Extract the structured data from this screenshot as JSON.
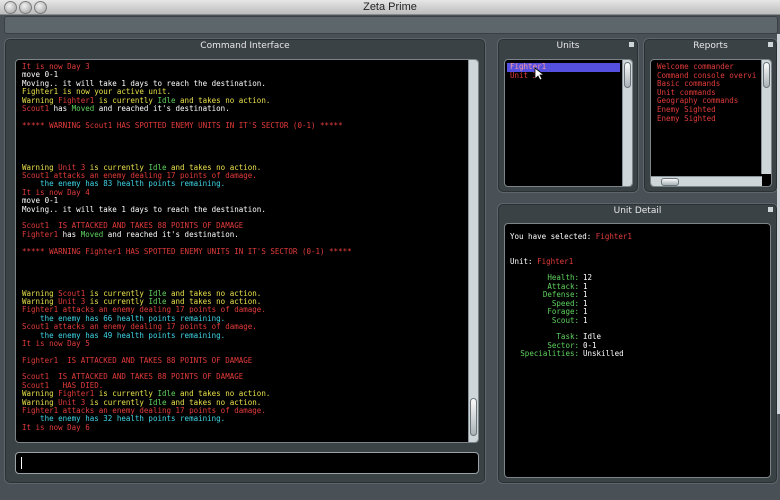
{
  "window": {
    "title": "Zeta Prime"
  },
  "command_panel": {
    "title": "Command Interface",
    "lines": [
      [
        {
          "t": "It is now Day 3",
          "c": "#e33b3b"
        }
      ],
      [
        {
          "t": "move 0-1",
          "c": "#ffffff"
        }
      ],
      [
        {
          "t": "Moving.. it will take 1 days to reach the destination.",
          "c": "#ffffff"
        }
      ],
      [
        {
          "t": "Fighter1 is now your active unit.",
          "c": "#e8e04a"
        }
      ],
      [
        {
          "t": "Warning ",
          "c": "#e8e04a"
        },
        {
          "t": "Fighter1",
          "c": "#e33b3b"
        },
        {
          "t": " is currently ",
          "c": "#e8e04a"
        },
        {
          "t": "Idle",
          "c": "#5fd35f"
        },
        {
          "t": " and takes no action.",
          "c": "#e8e04a"
        }
      ],
      [
        {
          "t": "Scout1",
          "c": "#e33b3b"
        },
        {
          "t": " has ",
          "c": "#ffffff"
        },
        {
          "t": "Moved",
          "c": "#5fd35f"
        },
        {
          "t": " and reached it's destination.",
          "c": "#ffffff"
        }
      ],
      [],
      [
        {
          "t": "***** WARNING Scout1 HAS SPOTTED ENEMY UNITS IN IT'S SECTOR (0-1) *****",
          "c": "#e33b3b"
        }
      ],
      [],
      [],
      [],
      [],
      [
        {
          "t": "Warning ",
          "c": "#e8e04a"
        },
        {
          "t": "Unit 3",
          "c": "#e33b3b"
        },
        {
          "t": " is currently ",
          "c": "#e8e04a"
        },
        {
          "t": "Idle",
          "c": "#5fd35f"
        },
        {
          "t": " and takes no action.",
          "c": "#e8e04a"
        }
      ],
      [
        {
          "t": "Scout1",
          "c": "#e33b3b"
        },
        {
          "t": " attacks an enemy dealing 17 points of damage.",
          "c": "#e33b3b"
        }
      ],
      [
        {
          "t": "    the enemy has 83 health points remaining.",
          "c": "#3fd6e6"
        }
      ],
      [
        {
          "t": "It is now Day 4",
          "c": "#e33b3b"
        }
      ],
      [
        {
          "t": "move 0-1",
          "c": "#ffffff"
        }
      ],
      [
        {
          "t": "Moving.. it will take 1 days to reach the destination.",
          "c": "#ffffff"
        }
      ],
      [],
      [
        {
          "t": "Scout1  IS ATTACKED AND TAKES 88 POINTS OF DAMAGE",
          "c": "#e33b3b"
        }
      ],
      [
        {
          "t": "Fighter1",
          "c": "#e33b3b"
        },
        {
          "t": " has ",
          "c": "#ffffff"
        },
        {
          "t": "Moved",
          "c": "#5fd35f"
        },
        {
          "t": " and reached it's destination.",
          "c": "#ffffff"
        }
      ],
      [],
      [
        {
          "t": "***** WARNING Fighter1 HAS SPOTTED ENEMY UNITS IN IT'S SECTOR (0-1) *****",
          "c": "#e33b3b"
        }
      ],
      [],
      [],
      [],
      [],
      [
        {
          "t": "Warning ",
          "c": "#e8e04a"
        },
        {
          "t": "Scout1",
          "c": "#e33b3b"
        },
        {
          "t": " is currently ",
          "c": "#e8e04a"
        },
        {
          "t": "Idle",
          "c": "#5fd35f"
        },
        {
          "t": " and takes no action.",
          "c": "#e8e04a"
        }
      ],
      [
        {
          "t": "Warning ",
          "c": "#e8e04a"
        },
        {
          "t": "Unit 3",
          "c": "#e33b3b"
        },
        {
          "t": " is currently ",
          "c": "#e8e04a"
        },
        {
          "t": "Idle",
          "c": "#5fd35f"
        },
        {
          "t": " and takes no action.",
          "c": "#e8e04a"
        }
      ],
      [
        {
          "t": "Fighter1",
          "c": "#e33b3b"
        },
        {
          "t": " attacks an enemy dealing 17 points of damage.",
          "c": "#e33b3b"
        }
      ],
      [
        {
          "t": "    the enemy has 66 health points remaining.",
          "c": "#3fd6e6"
        }
      ],
      [
        {
          "t": "Scout1",
          "c": "#e33b3b"
        },
        {
          "t": " attacks an enemy dealing 17 points of damage.",
          "c": "#e33b3b"
        }
      ],
      [
        {
          "t": "    the enemy has 49 health points remaining.",
          "c": "#3fd6e6"
        }
      ],
      [
        {
          "t": "It is now Day 5",
          "c": "#e33b3b"
        }
      ],
      [],
      [
        {
          "t": "Fighter1  IS ATTACKED AND TAKES 88 POINTS OF DAMAGE",
          "c": "#e33b3b"
        }
      ],
      [],
      [
        {
          "t": "Scout1  IS ATTACKED AND TAKES 88 POINTS OF DAMAGE",
          "c": "#e33b3b"
        }
      ],
      [
        {
          "t": "Scout1",
          "c": "#e33b3b"
        },
        {
          "t": "   HAS DIED.",
          "c": "#e33b3b"
        }
      ],
      [
        {
          "t": "Warning ",
          "c": "#e8e04a"
        },
        {
          "t": "Fighter1",
          "c": "#e33b3b"
        },
        {
          "t": " is currently ",
          "c": "#e8e04a"
        },
        {
          "t": "Idle",
          "c": "#5fd35f"
        },
        {
          "t": " and takes no action.",
          "c": "#e8e04a"
        }
      ],
      [
        {
          "t": "Warning ",
          "c": "#e8e04a"
        },
        {
          "t": "Unit 3",
          "c": "#e33b3b"
        },
        {
          "t": " is currently ",
          "c": "#e8e04a"
        },
        {
          "t": "Idle",
          "c": "#5fd35f"
        },
        {
          "t": " and takes no action.",
          "c": "#e8e04a"
        }
      ],
      [
        {
          "t": "Fighter1",
          "c": "#e33b3b"
        },
        {
          "t": " attacks an enemy dealing 17 points of damage.",
          "c": "#e33b3b"
        }
      ],
      [
        {
          "t": "    the enemy has 32 health points remaining.",
          "c": "#3fd6e6"
        }
      ],
      [
        {
          "t": "It is now Day 6",
          "c": "#e33b3b"
        }
      ]
    ],
    "input_value": ""
  },
  "units_panel": {
    "title": "Units",
    "items": [
      {
        "label": "Fighter1",
        "selected": true
      },
      {
        "label": "Unit 3",
        "selected": false
      }
    ]
  },
  "reports_panel": {
    "title": "Reports",
    "items": [
      "Welcome commander",
      "Command console overvi",
      "Basic commands",
      "Unit commands",
      "Geography commands",
      "Enemy Sighted",
      "Enemy Sighted"
    ]
  },
  "unit_detail": {
    "title": "Unit Detail",
    "selected_prefix": "You have selected: ",
    "selected_name": "Fighter1",
    "unit_prefix": "Unit: ",
    "unit_name": "Fighter1",
    "stats": [
      {
        "label": "Health:",
        "value": "12"
      },
      {
        "label": "Attack:",
        "value": "1"
      },
      {
        "label": "Defense:",
        "value": "1"
      },
      {
        "label": "Speed:",
        "value": "1"
      },
      {
        "label": "Forage:",
        "value": "1"
      },
      {
        "label": "Scout:",
        "value": "1"
      }
    ],
    "info": [
      {
        "label": "Task:",
        "value": "Idle"
      },
      {
        "label": "Sector:",
        "value": "0-1"
      },
      {
        "label": "Specialities:",
        "value": "Unskilled"
      }
    ]
  },
  "colors": {
    "red": "#e33b3b",
    "yellow": "#e8e04a",
    "green": "#5fd35f",
    "cyan": "#3fd6e6",
    "white": "#ffffff",
    "selection": "#5550e0"
  }
}
